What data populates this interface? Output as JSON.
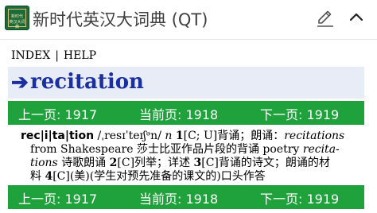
{
  "app": {
    "icon_text": [
      "新时代",
      "英汉大词典"
    ],
    "title": "新时代英汉大词典 (QT)"
  },
  "nav": {
    "index": "INDEX",
    "separator": "|",
    "help": "HELP"
  },
  "headword": {
    "arrow": "➔",
    "word": "recitation"
  },
  "pager": {
    "prev": "上一页: 1917",
    "current": "当前页: 1918",
    "next": "下一页: 1919"
  },
  "entry": {
    "syllables": "rec|i|ta|tion",
    "pronunciation": "/ˌresɪˈteɪʃᵊn/",
    "pos": "n",
    "sense1_num": "1",
    "sense1_label": "[C; U]",
    "sense1_def": "背诵；朗诵：",
    "ex1_it_a": "recitations",
    "ex1_rm_a": "from Shakespeare 莎士比亚作品片段的背诵 poetry",
    "ex1_it_b": "recita-",
    "ex1_it_c": "tions",
    "ex1_rm_b": "诗歌朗诵",
    "sense2_num": "2",
    "sense2_label": "[C]",
    "sense2_def": "列举；详述",
    "sense3_num": "3",
    "sense3_label": "[C]",
    "sense3_def": "背诵的诗文；朗诵的材",
    "sense3_def_b": "料",
    "sense4_num": "4",
    "sense4_label": "[C]",
    "sense4_def": "(美)(学生对预先准备的课文的)口头作答"
  }
}
